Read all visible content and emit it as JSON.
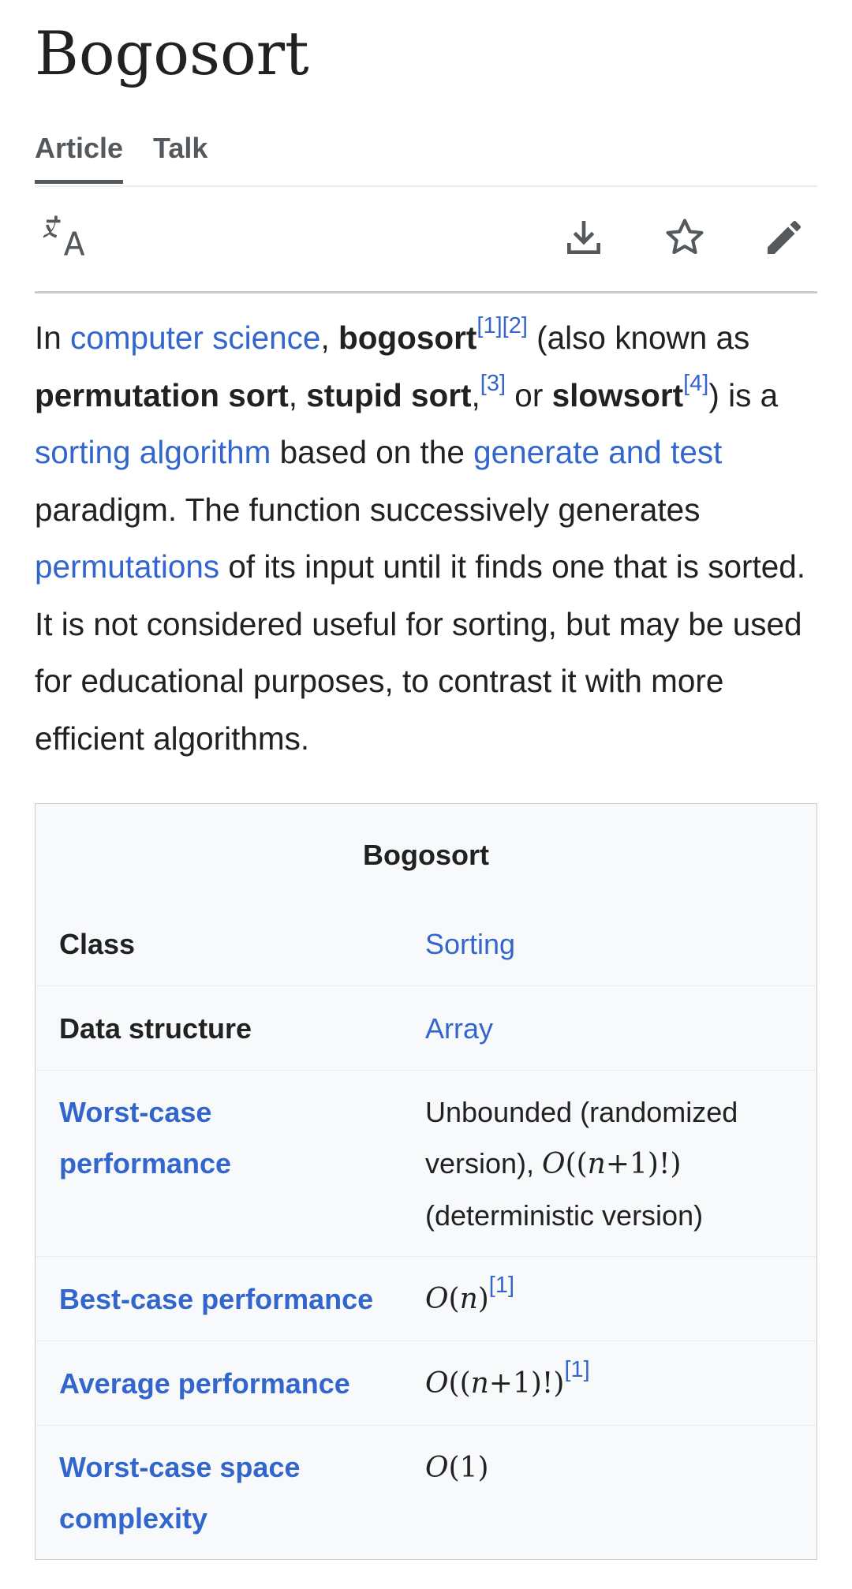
{
  "article": {
    "title": "Bogosort"
  },
  "tabs": [
    {
      "label": "Article"
    },
    {
      "label": "Talk"
    }
  ],
  "toolbar": {
    "icons": [
      "language-icon",
      "download-icon",
      "star-icon",
      "edit-icon"
    ]
  },
  "intro": {
    "p1": "In ",
    "link_cs": "computer science",
    "p2": ", ",
    "bold_bogosort": "bogosort",
    "ref1": "[1]",
    "ref2": "[2]",
    "p3": " (also known as ",
    "bold_perm": "permutation sort",
    "p4": ", ",
    "bold_stupid": "stupid sort",
    "p5": ",",
    "ref3": "[3]",
    "p6": " or ",
    "bold_slow": "slowsort",
    "ref4": "[4]",
    "p7": ") is a ",
    "link_sorting": "sorting algorithm",
    "p8": " based on the ",
    "link_generate": "generate and test",
    "p9": " paradigm. The function successively generates ",
    "link_perms": "permutations",
    "p10": " of its input until it finds one that is sorted. It is not considered useful for sorting, but may be used for educational purposes, to contrast it with more efficient algorithms."
  },
  "infobox": {
    "caption": "Bogosort",
    "class_label": "Class",
    "class_value": "Sorting",
    "ds_label": "Data structure",
    "ds_value": "Array",
    "worst_label_1": "Worst-case",
    "worst_label_2": "performance",
    "worst_value_1": "Unbounded (randomized",
    "worst_value_2a": "version), ",
    "worst_math": "O((n+1)!)",
    "worst_value_3": "(deterministic version)",
    "best_label": "Best-case performance",
    "best_math": "O(n)",
    "best_ref": "[1]",
    "avg_label": "Average performance",
    "avg_math": "O((n+1)!)",
    "avg_ref": "[1]",
    "space_label_1": "Worst-case space",
    "space_label_2": "complexity",
    "space_math": "O(1)"
  },
  "colors": {
    "link": "#3366cc",
    "text": "#202122",
    "infobox_bg": "#f8f9fa"
  }
}
